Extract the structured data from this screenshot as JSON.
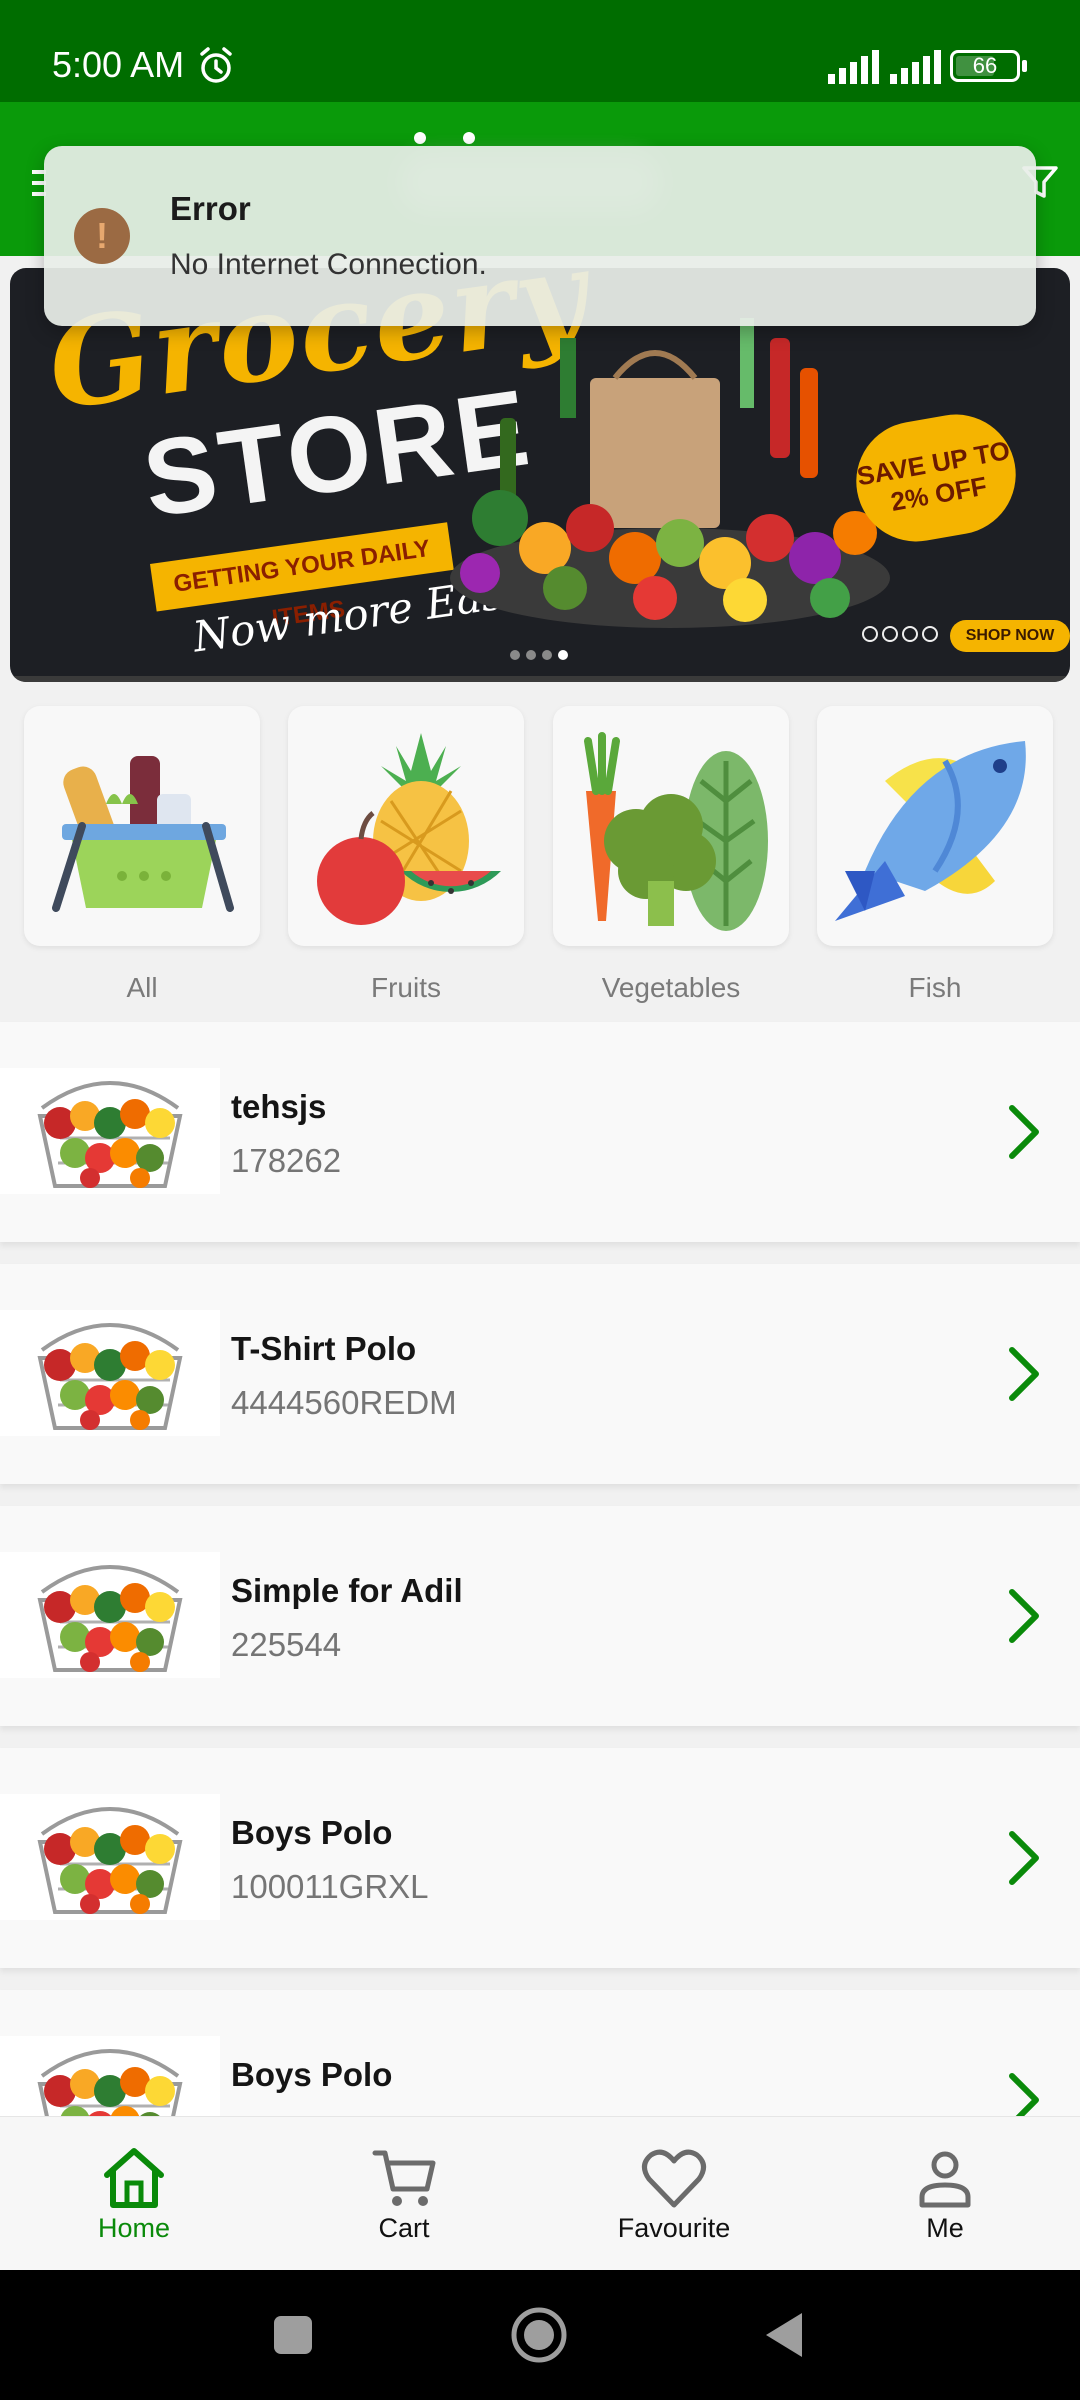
{
  "status_bar": {
    "time": "5:00 AM",
    "battery": "66",
    "battery_level": 0.66,
    "icons": [
      "alarm-icon",
      "signal-icon",
      "signal-icon",
      "battery-icon"
    ]
  },
  "header": {
    "icons": [
      "menu-icon",
      "filter-icon"
    ]
  },
  "error_toast": {
    "title": "Error",
    "message": "No Internet Connection.",
    "icon": "warning-icon"
  },
  "banner": {
    "title_line1": "Grocery",
    "title_line2": "STORE",
    "ribbon": "GETTING YOUR DAILY ITEMS",
    "subtitle": "Now more Easier",
    "save_badge": "SAVE UP TO 2% OFF",
    "shop_now": "SHOP NOW",
    "slide_count": 4,
    "active_slide": 4
  },
  "categories": [
    {
      "label": "All",
      "icon": "basket-icon"
    },
    {
      "label": "Fruits",
      "icon": "fruits-icon"
    },
    {
      "label": "Vegetables",
      "icon": "vegetables-icon"
    },
    {
      "label": "Fish",
      "icon": "fish-icon"
    }
  ],
  "products": [
    {
      "name": "tehsjs",
      "code": "178262"
    },
    {
      "name": "T-Shirt Polo",
      "code": "4444560REDM"
    },
    {
      "name": "Simple for Adil",
      "code": "225544"
    },
    {
      "name": "Boys Polo",
      "code": "100011GRXL"
    },
    {
      "name": "Boys Polo",
      "code": ""
    }
  ],
  "bottom_nav": {
    "items": [
      {
        "label": "Home",
        "icon": "home-icon",
        "active": true
      },
      {
        "label": "Cart",
        "icon": "cart-icon",
        "active": false
      },
      {
        "label": "Favourite",
        "icon": "heart-icon",
        "active": false
      },
      {
        "label": "Me",
        "icon": "person-icon",
        "active": false
      }
    ]
  },
  "colors": {
    "status_bar": "#006d00",
    "header": "#0a9a0a",
    "accent": "#0a8a0a",
    "banner_yellow": "#f5b400"
  }
}
